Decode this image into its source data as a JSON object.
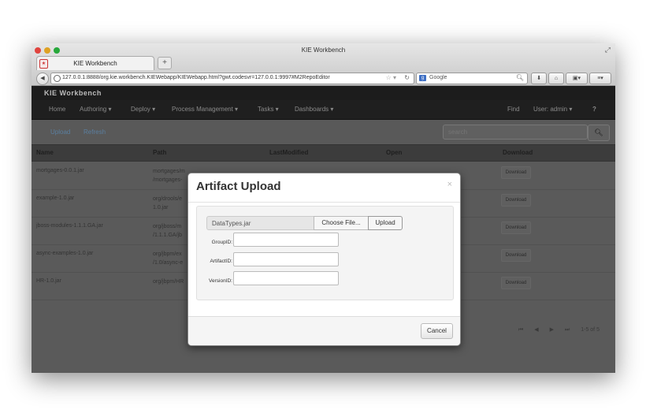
{
  "window": {
    "title": "KIE Workbench",
    "tab_label": "KIE Workbench",
    "new_tab": "+",
    "url": "127.0.0.1:8888/org.kie.workbench.KIEWebapp/KIEWebapp.html?gwt.codesvr=127.0.0.1:9997#M2RepoEditor",
    "search_engine_placeholder": "Google"
  },
  "app": {
    "brand": "KIE Workbench",
    "nav": {
      "home": "Home",
      "authoring": "Authoring ▾",
      "deploy": "Deploy ▾",
      "process_management": "Process Management ▾",
      "tasks": "Tasks ▾",
      "dashboards": "Dashboards ▾",
      "find": "Find",
      "user": "User: admin ▾",
      "help": "?"
    },
    "toolbar": {
      "upload": "Upload",
      "refresh": "Refresh",
      "search_placeholder": "search"
    },
    "table": {
      "headers": {
        "name": "Name",
        "path": "Path",
        "last_modified": "LastModified",
        "open": "Open",
        "download": "Download"
      },
      "rows": [
        {
          "name": "mortgages-0.0.1.jar",
          "path_line1": "mortgages/m",
          "path_line2": "/mortgages-",
          "download": "Download"
        },
        {
          "name": "example-1.0.jar",
          "path_line1": "org/drools/e",
          "path_line2": "1.0.jar",
          "download": "Download"
        },
        {
          "name": "jboss-modules-1.1.1.GA.jar",
          "path_line1": "org/jboss/m",
          "path_line2": "/1.1.1.GA/jb",
          "download": "Download"
        },
        {
          "name": "async-examples-1.0.jar",
          "path_line1": "org/jbpm/ex",
          "path_line2": "/1.0/async-e",
          "download": "Download"
        },
        {
          "name": "HR-1.0.jar",
          "path_line1": "org/jbpm/HR",
          "path_line2": "",
          "download": "Download"
        }
      ]
    },
    "pager": {
      "first": "⏮",
      "prev": "◀",
      "next": "▶",
      "last": "⏭",
      "range": "1-5 of 5"
    }
  },
  "modal": {
    "title": "Artifact Upload",
    "close": "×",
    "file_name": "DataTypes.jar",
    "choose_file": "Choose File...",
    "upload": "Upload",
    "group_id_label": "GroupID:",
    "artifact_id_label": "ArtifactID:",
    "version_id_label": "VersionID:",
    "group_id_value": "",
    "artifact_id_value": "",
    "version_id_value": "",
    "cancel": "Cancel"
  }
}
